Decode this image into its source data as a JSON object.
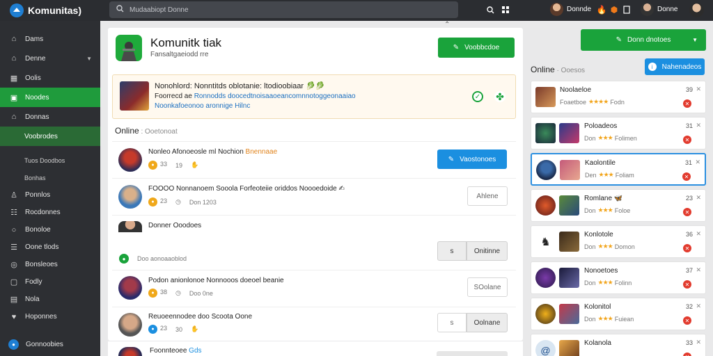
{
  "app": {
    "name": "Komunitas)"
  },
  "search": {
    "placeholder": "Mudaabiopt Donne"
  },
  "topbar": {
    "user1_name": "Donnde",
    "user2_name": "Donne"
  },
  "sidebar": {
    "items": [
      {
        "label": "Dams",
        "icon": "home-icon"
      },
      {
        "label": "Denne",
        "icon": "home-icon",
        "has_caret": true
      },
      {
        "label": "Oolis",
        "icon": "building-icon"
      },
      {
        "label": "Noodes",
        "icon": "folder-icon",
        "active": true
      },
      {
        "label": "Donnas",
        "icon": "home-icon"
      },
      {
        "label": "Voobrodes",
        "subactive": true
      }
    ],
    "subitems": [
      {
        "label": "Tuos Doodbos"
      },
      {
        "label": "Bonhas"
      },
      {
        "label": "Ponnlos",
        "icon": "user-icon"
      },
      {
        "label": "Rocdonnes",
        "icon": "users-icon"
      },
      {
        "label": "Bonoloe",
        "icon": "gear-icon"
      },
      {
        "label": "Oone tlods",
        "icon": "list-icon"
      },
      {
        "label": "Bonsleoes",
        "icon": "settings-icon"
      },
      {
        "label": "Fodly",
        "icon": "box-icon"
      },
      {
        "label": "Nola",
        "icon": "doc-icon"
      },
      {
        "label": "Hoponnes",
        "icon": "heart-icon"
      }
    ],
    "bottom_label": "Gonnoobies"
  },
  "main": {
    "title": "Komunitk tiak",
    "subtitle": "Fansaltgaeiodd rre",
    "header_button": "Voobbcdoe",
    "promo": {
      "title": "Nonohlord: Nonntitds oblotanie: ltodioobiaar 🥬🥬",
      "line2_a": "Foorrecd ae",
      "line2_b": "Ronnodds doocedtnoisaaoeancomnnotoggeonaaiao",
      "line3": "Noonkafoeonoo aronnige Hilnc"
    },
    "section_label": "Online",
    "section_sub": "Ooetonoat",
    "rows": [
      {
        "title_a": "Nonleo Afonoeosle ml Nochion",
        "title_b": "Bnennaae",
        "count_a": "33",
        "count_b": "19",
        "button": "Vaostonoes"
      },
      {
        "title_a": "FOOOO Nonnanoem Sooola Forfeoteiie oriddos Noooedoide ✍",
        "count_a": "23",
        "count_b": "Don 1203",
        "button": "Ahlene"
      },
      {
        "title_a": "Donner Ooodoes",
        "status": "Doo aonoaaoblod",
        "button_a": "s",
        "button_b": "Onitinne"
      },
      {
        "title_a": "Podon anionlonoe Nonnooos doeoel beanie",
        "count_a": "38",
        "count_b": "Doo 0ne",
        "button": "SOolane"
      },
      {
        "title_a": "Reuoeennodee doo Scoota Oone",
        "count_a": "23",
        "count_b": "30",
        "button_a": "s",
        "button_b": "Oolnane"
      },
      {
        "title_a": "Foonnteoee",
        "title_b": "Gds"
      }
    ]
  },
  "right": {
    "top_button": "Donn dnotoes",
    "label": "Online",
    "label_sub": "Ooesos",
    "blue_button": "Nahenadeos",
    "cards": [
      {
        "title": "Noolaeloe",
        "sub": "Foaetboe",
        "sub2": "Fodn",
        "num": "39"
      },
      {
        "title": "Poloadeos",
        "sub": "Don",
        "sub2": "Folimen",
        "num": "31"
      },
      {
        "title": "Kaolontile",
        "sub": "Den",
        "sub2": "Foliam",
        "num": "31"
      },
      {
        "title": "Romlane 🦋",
        "sub": "Don",
        "sub2": "Foloe",
        "num": "23"
      },
      {
        "title": "Konlotole",
        "sub": "Don",
        "sub2": "Domon",
        "num": "36"
      },
      {
        "title": "Nonoetoes",
        "sub": "Don",
        "sub2": "Folinn",
        "num": "37"
      },
      {
        "title": "Kolonitol",
        "sub": "Don",
        "sub2": "Fuiean",
        "num": "32"
      },
      {
        "title": "Kolanola",
        "sub": "Don",
        "sub2": "Dioon",
        "num": "33"
      }
    ]
  },
  "colors": {
    "accent_green": "#1aa33b",
    "accent_blue": "#1b8fe0",
    "danger": "#e23b2e",
    "sidebar_bg": "#2d2f33"
  }
}
